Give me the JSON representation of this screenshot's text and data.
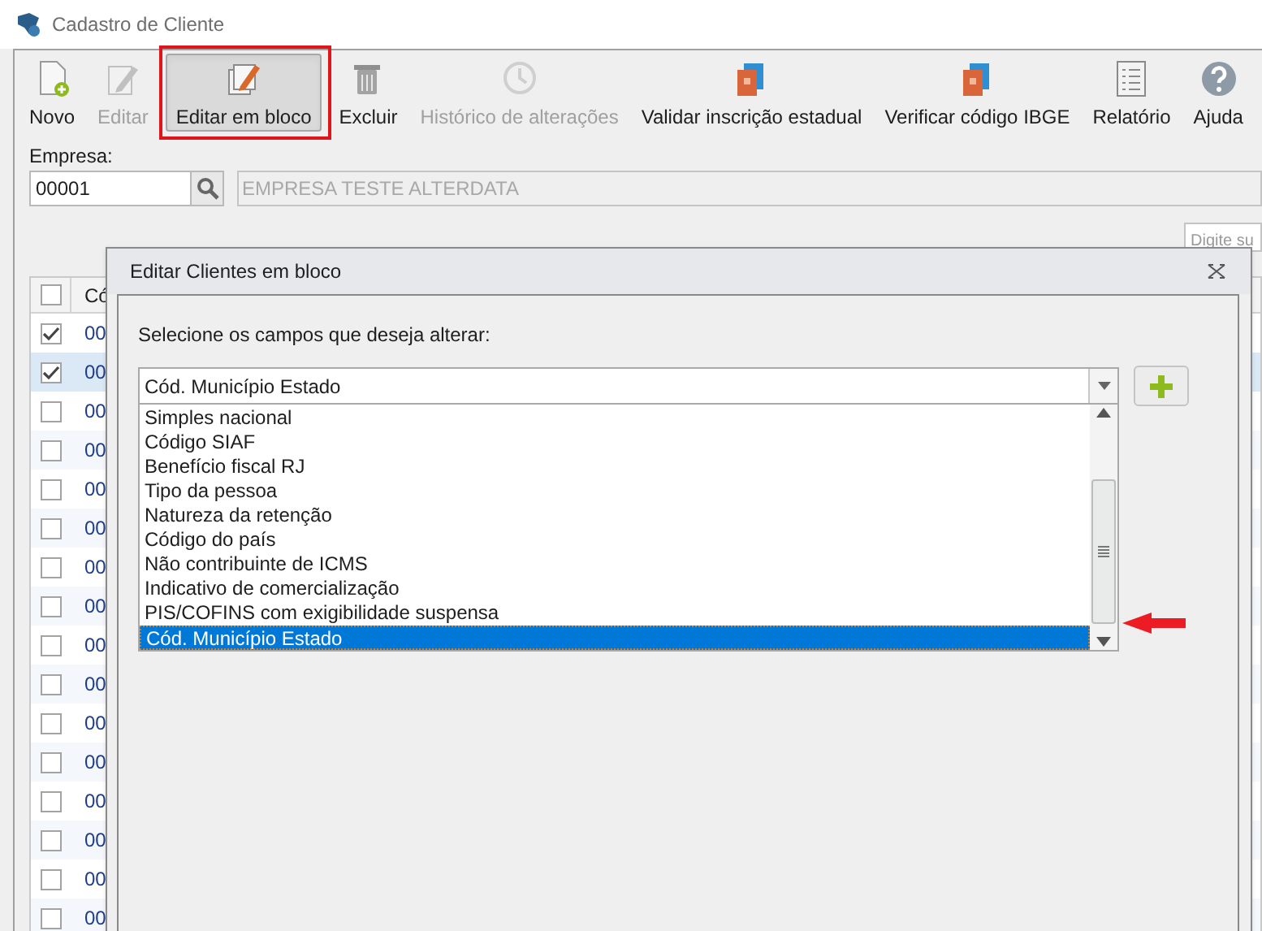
{
  "window": {
    "title": "Cadastro de Cliente"
  },
  "toolbar": [
    {
      "label": "Novo",
      "kind": "new",
      "disabled": false,
      "selected": false
    },
    {
      "label": "Editar",
      "kind": "edit",
      "disabled": true,
      "selected": false
    },
    {
      "label": "Editar em bloco",
      "kind": "block",
      "disabled": false,
      "selected": true
    },
    {
      "label": "Excluir",
      "kind": "delete",
      "disabled": false,
      "selected": false
    },
    {
      "label": "Histórico de alterações",
      "kind": "history",
      "disabled": true,
      "selected": false
    },
    {
      "label": "Validar inscrição estadual",
      "kind": "book",
      "disabled": false,
      "selected": false
    },
    {
      "label": "Verificar código IBGE",
      "kind": "book",
      "disabled": false,
      "selected": false
    },
    {
      "label": "Relatório",
      "kind": "report",
      "disabled": false,
      "selected": false
    },
    {
      "label": "Ajuda",
      "kind": "help",
      "disabled": false,
      "selected": false
    }
  ],
  "empresa": {
    "label": "Empresa:",
    "code": "00001",
    "name": "EMPRESA TESTE ALTERDATA"
  },
  "grid_search": {
    "placeholder": "Digite su"
  },
  "grid": {
    "header_checked": false,
    "column_2": "Có",
    "rows": [
      {
        "checked": true,
        "selected": false,
        "cell": "00"
      },
      {
        "checked": true,
        "selected": true,
        "cell": "00"
      },
      {
        "checked": false,
        "selected": false,
        "cell": "00"
      },
      {
        "checked": false,
        "selected": false,
        "cell": "00"
      },
      {
        "checked": false,
        "selected": false,
        "cell": "00"
      },
      {
        "checked": false,
        "selected": false,
        "cell": "00"
      },
      {
        "checked": false,
        "selected": false,
        "cell": "00"
      },
      {
        "checked": false,
        "selected": false,
        "cell": "00"
      },
      {
        "checked": false,
        "selected": false,
        "cell": "00"
      },
      {
        "checked": false,
        "selected": false,
        "cell": "00"
      },
      {
        "checked": false,
        "selected": false,
        "cell": "00"
      },
      {
        "checked": false,
        "selected": false,
        "cell": "00"
      },
      {
        "checked": false,
        "selected": false,
        "cell": "00"
      },
      {
        "checked": false,
        "selected": false,
        "cell": "00"
      },
      {
        "checked": false,
        "selected": false,
        "cell": "00"
      },
      {
        "checked": false,
        "selected": false,
        "cell": "00"
      }
    ]
  },
  "dialog": {
    "title": "Editar Clientes em bloco",
    "prompt": "Selecione os campos que deseja alterar:",
    "combo_value": "Cód. Município Estado",
    "options": [
      {
        "label": "Simples nacional",
        "selected": false
      },
      {
        "label": "Código SIAF",
        "selected": false
      },
      {
        "label": "Benefício fiscal RJ",
        "selected": false
      },
      {
        "label": "Tipo da pessoa",
        "selected": false
      },
      {
        "label": "Natureza da retenção",
        "selected": false
      },
      {
        "label": "Código do país",
        "selected": false
      },
      {
        "label": "Não contribuinte de ICMS",
        "selected": false
      },
      {
        "label": "Indicativo de comercialização",
        "selected": false
      },
      {
        "label": "PIS/COFINS com exigibilidade suspensa",
        "selected": false
      },
      {
        "label": "Cód. Município Estado",
        "selected": true
      }
    ]
  }
}
